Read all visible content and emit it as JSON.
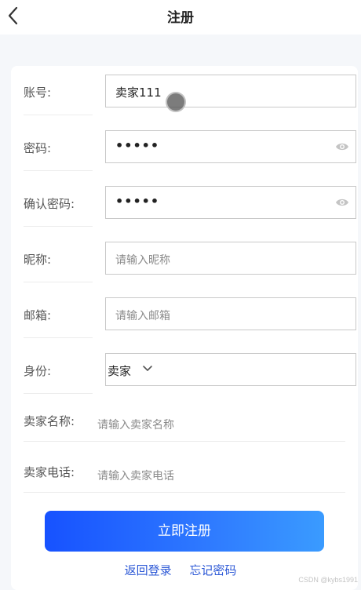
{
  "header": {
    "title": "注册",
    "back_icon": "chevron-left-icon"
  },
  "form": {
    "account": {
      "label": "账号:",
      "value": "卖家111"
    },
    "password": {
      "label": "密码:",
      "value": "•••••"
    },
    "confirm": {
      "label": "确认密码:",
      "value": "•••••"
    },
    "nickname": {
      "label": "昵称:",
      "placeholder": "请输入昵称"
    },
    "email": {
      "label": "邮箱:",
      "placeholder": "请输入邮箱"
    },
    "role": {
      "label": "身份:",
      "selected": "卖家"
    },
    "seller_name": {
      "label": "卖家名称:",
      "placeholder": "请输入卖家名称"
    },
    "seller_phone": {
      "label": "卖家电话:",
      "placeholder": "请输入卖家电话"
    }
  },
  "actions": {
    "submit_label": "立即注册",
    "back_login": "返回登录",
    "forgot_password": "忘记密码"
  },
  "watermark": "CSDN @kybs1991",
  "colors": {
    "primary": "#1752ff",
    "link": "#2c58d6"
  }
}
